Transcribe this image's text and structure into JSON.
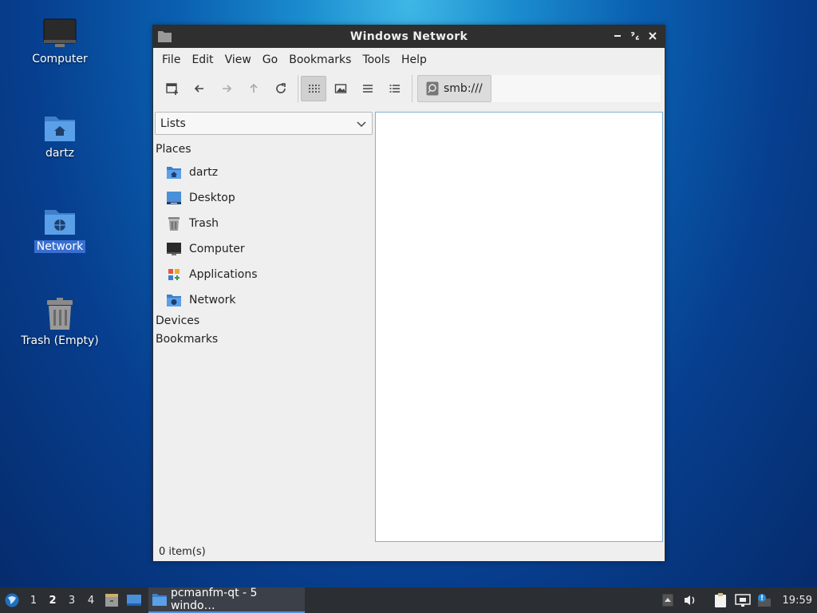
{
  "desktop": {
    "icons": [
      {
        "label": "Computer",
        "icon": "monitor-icon"
      },
      {
        "label": "dartz",
        "icon": "home-folder-icon"
      },
      {
        "label": "Network",
        "icon": "network-folder-icon"
      },
      {
        "label": "Trash (Empty)",
        "icon": "trash-icon"
      }
    ]
  },
  "window": {
    "title": "Windows Network",
    "menu": [
      "File",
      "Edit",
      "View",
      "Go",
      "Bookmarks",
      "Tools",
      "Help"
    ],
    "path": "smb:///",
    "sidebar": {
      "mode": "Lists",
      "sections": {
        "places": "Places",
        "devices": "Devices",
        "bookmarks": "Bookmarks"
      },
      "places": [
        "dartz",
        "Desktop",
        "Trash",
        "Computer",
        "Applications",
        "Network"
      ]
    },
    "status": "0 item(s)"
  },
  "taskbar": {
    "workspaces": [
      "1",
      "2",
      "3",
      "4"
    ],
    "active_workspace": "2",
    "task": "pcmanfm-qt - 5 windo…",
    "clock": "19:59"
  },
  "colors": {
    "accent": "#3a6fd0",
    "folder": "#4a90d9",
    "titlebar": "#2f2f2f",
    "taskbar": "#2b2e33"
  }
}
